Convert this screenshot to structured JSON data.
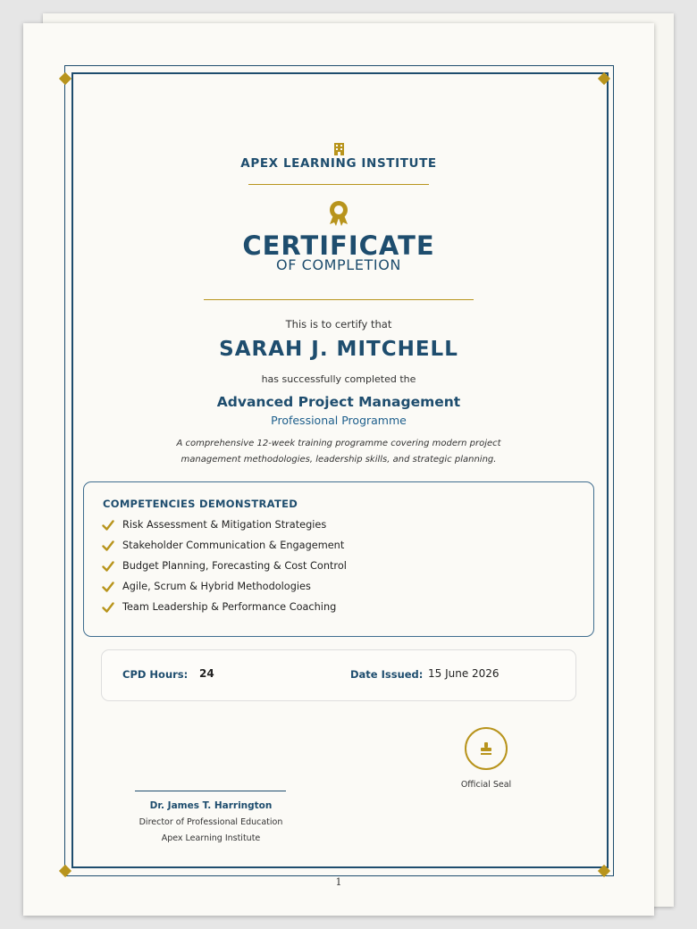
{
  "institution": {
    "name": "APEX LEARNING INSTITUTE",
    "icon": "building-icon"
  },
  "certificate": {
    "title": "CERTIFICATE",
    "subtitle": "OF COMPLETION",
    "icon": "award-ribbon-icon",
    "certify_text": "This is to certify that",
    "recipient": "SARAH J. MITCHELL",
    "completed_text": "has successfully completed the",
    "course_name": "Advanced Project Management",
    "course_type": "Professional Programme",
    "description_line1": "A comprehensive 12-week training programme covering modern project",
    "description_line2": "management methodologies, leadership skills, and strategic planning."
  },
  "competencies": {
    "title": "COMPETENCIES DEMONSTRATED",
    "items": [
      "Risk Assessment & Mitigation Strategies",
      "Stakeholder Communication & Engagement",
      "Budget Planning, Forecasting & Cost Control",
      "Agile, Scrum & Hybrid Methodologies",
      "Team Leadership & Performance Coaching"
    ]
  },
  "details": {
    "cpd_label": "CPD Hours:",
    "cpd_value": "24",
    "date_label": "Date Issued:",
    "date_value": "15 June 2026"
  },
  "seal": {
    "label": "Official Seal",
    "icon": "stamp-icon"
  },
  "signatory": {
    "name": "Dr. James T. Harrington",
    "title": "Director of Professional Education",
    "organization": "Apex Learning Institute"
  },
  "page": {
    "number": "1"
  },
  "colors": {
    "navy": "#1e4d6e",
    "gold": "#b8941c",
    "paper": "#fbfaf6"
  }
}
